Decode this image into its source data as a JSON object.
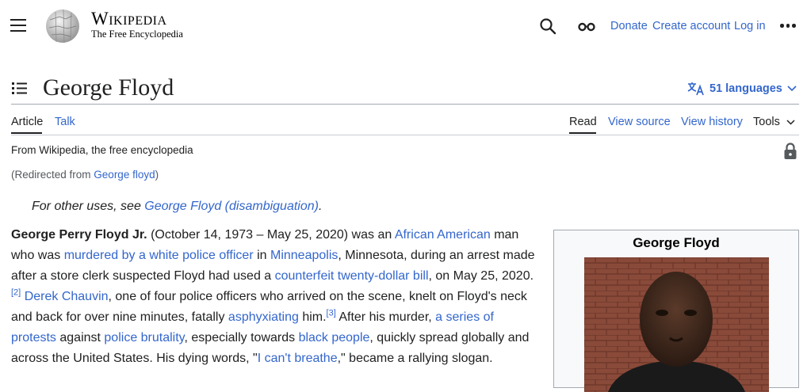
{
  "header": {
    "wordmark": "Wikipedia",
    "tagline": "The Free Encyclopedia",
    "links": {
      "donate": "Donate",
      "create_account": "Create account",
      "log_in": "Log in"
    }
  },
  "title_row": {
    "title": "George Floyd",
    "languages": "51 languages"
  },
  "tabs": {
    "article": "Article",
    "talk": "Talk",
    "read": "Read",
    "view_source": "View source",
    "view_history": "View history",
    "tools": "Tools"
  },
  "content": {
    "tagline": "From Wikipedia, the free encyclopedia",
    "redirect_prefix": "(Redirected from ",
    "redirect_link": "George floyd",
    "redirect_suffix": ")",
    "hatnote_prefix": "For other uses, see ",
    "hatnote_link": "George Floyd (disambiguation)",
    "hatnote_suffix": ".",
    "lead": {
      "s1": "George Perry Floyd Jr.",
      "s2": " (October 14, 1973 – May 25, 2020) was an ",
      "l1": "African American",
      "s3": " man who was ",
      "l2": "murdered by a white police officer",
      "s4": " in ",
      "l3": "Minneapolis",
      "s5": ", Minnesota, during an arrest made after a store clerk suspected Floyd had used a ",
      "l4": "counterfeit twenty-dollar bill",
      "s6": ", on May 25, 2020.",
      "ref1": "[2]",
      "s7": " ",
      "l5": "Derek Chauvin",
      "s8": ", one of four police officers who arrived on the scene, knelt on Floyd's neck and back for over nine minutes, fatally ",
      "l6": "asphyxiating",
      "s9": " him.",
      "ref2": "[3]",
      "s10": " After his murder, ",
      "l7": "a series of protests",
      "s11": " against ",
      "l8": "police brutality",
      "s12": ", especially towards ",
      "l9": "black people",
      "s13": ", quickly spread globally and across the United States. His dying words, \"",
      "l10": "I can't breathe",
      "s14": ",\" became a rallying slogan."
    }
  },
  "infobox": {
    "title": "George Floyd"
  },
  "icons": {
    "menu": "hamburger-menu-icon",
    "search": "search-icon",
    "appearance": "glasses-icon",
    "more": "ellipsis-icon",
    "toc": "table-of-contents-icon",
    "language": "translate-icon",
    "chevron": "chevron-down-icon",
    "lock": "lock-icon"
  },
  "colors": {
    "link": "#3366cc",
    "text": "#202122",
    "border": "#a2a9b1"
  }
}
